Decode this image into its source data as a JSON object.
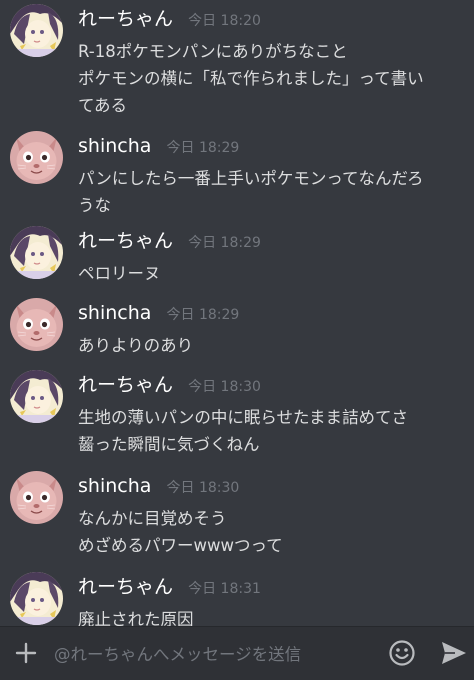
{
  "messages": [
    {
      "author": "れーちゃん",
      "timestamp": "今日 18:20",
      "avatar": "girl-avatar",
      "lines": [
        "R-18ポケモンパンにありがちなこと",
        "ポケモンの横に「私で作られました」って書い",
        "てある"
      ]
    },
    {
      "author": "shincha",
      "timestamp": "今日 18:29",
      "avatar": "cat-avatar",
      "lines": [
        "パンにしたら一番上手いポケモンってなんだろ",
        "うな"
      ]
    },
    {
      "author": "れーちゃん",
      "timestamp": "今日 18:29",
      "avatar": "girl-avatar",
      "lines": [
        "ペロリーヌ"
      ]
    },
    {
      "author": "shincha",
      "timestamp": "今日 18:29",
      "avatar": "cat-avatar",
      "lines": [
        "ありよりのあり"
      ]
    },
    {
      "author": "れーちゃん",
      "timestamp": "今日 18:30",
      "avatar": "girl-avatar",
      "lines": [
        "生地の薄いパンの中に眠らせたまま詰めてさ",
        "齧った瞬間に気づくねん"
      ]
    },
    {
      "author": "shincha",
      "timestamp": "今日 18:30",
      "avatar": "cat-avatar",
      "lines": [
        "なんかに目覚めそう",
        "めざめるパワーwwwつって"
      ]
    },
    {
      "author": "れーちゃん",
      "timestamp": "今日 18:31",
      "avatar": "girl-avatar",
      "lines": [
        "廃止された原因"
      ]
    }
  ],
  "composer": {
    "placeholder": "@れーちゃんへメッセージを送信",
    "value": ""
  },
  "icons": {
    "add": "plus-icon",
    "emoji": "emoji-icon",
    "send": "send-icon"
  },
  "colors": {
    "background": "#36393f",
    "composer_bg": "#2f3136",
    "author": "#ffffff",
    "timestamp": "#72767d",
    "text": "#dcddde",
    "icon": "#b9bbbe"
  }
}
